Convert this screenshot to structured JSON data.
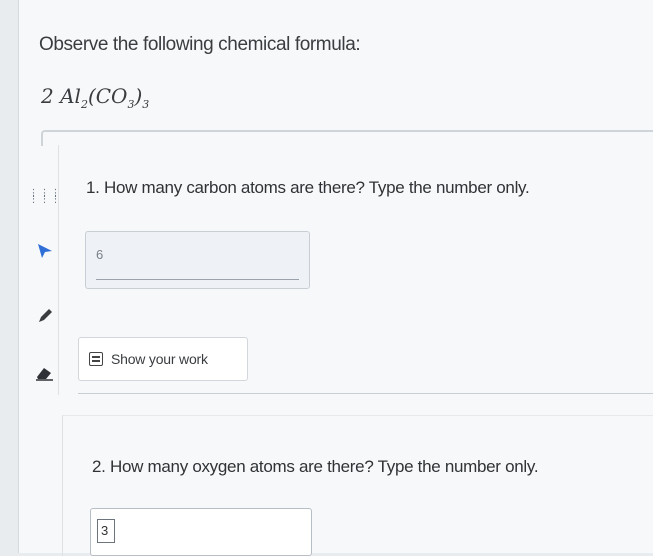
{
  "question": {
    "prompt": "Observe the following chemical formula:",
    "formula": {
      "coef": "2",
      "al": "Al",
      "al_sub": "2",
      "co": "CO",
      "co_sub": "3",
      "paren_sub": "3"
    }
  },
  "items": [
    {
      "number_text": "1. How many carbon atoms are there? Type the number only.",
      "answer_value": "6"
    },
    {
      "number_text": "2. How many oxygen atoms are there? Type the number only.",
      "answer_value": "3"
    }
  ],
  "show_work": {
    "label": "Show your work",
    "icon": "document-lines-icon"
  },
  "tools": [
    {
      "name": "grip-icon"
    },
    {
      "name": "pointer-arrow-icon",
      "color": "#2f6fd6"
    },
    {
      "name": "pen-icon"
    },
    {
      "name": "eraser-icon"
    }
  ],
  "colors": {
    "accent": "#2f6fd6",
    "page_bg": "#f7f8f9",
    "box_bg": "#eef2f6"
  }
}
